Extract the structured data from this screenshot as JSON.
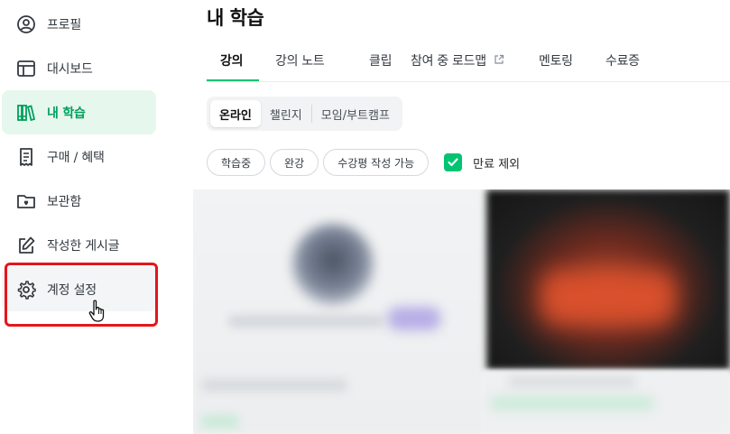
{
  "sidebar": {
    "items": [
      {
        "label": "프로필",
        "icon": "user-circle-icon"
      },
      {
        "label": "대시보드",
        "icon": "dashboard-icon"
      },
      {
        "label": "내 학습",
        "icon": "books-icon",
        "active": true
      },
      {
        "label": "구매 / 혜택",
        "icon": "receipt-icon"
      },
      {
        "label": "보관함",
        "icon": "folder-heart-icon"
      },
      {
        "label": "작성한 게시글",
        "icon": "edit-icon"
      },
      {
        "label": "계정 설정",
        "icon": "gear-icon"
      }
    ]
  },
  "main": {
    "title": "내 학습",
    "tabs": [
      {
        "label": "강의",
        "active": true
      },
      {
        "label": "강의 노트"
      },
      {
        "label": "클립"
      },
      {
        "label": "참여 중 로드맵"
      },
      {
        "label": "멘토링"
      },
      {
        "label": "수료증"
      }
    ],
    "segments": [
      {
        "label": "온라인",
        "active": true
      },
      {
        "label": "챌린지"
      },
      {
        "label": "모임/부트캠프"
      }
    ],
    "filters": [
      "학습중",
      "완강",
      "수강평 작성 가능"
    ],
    "checkbox": {
      "label": "만료 제외",
      "checked": true
    }
  },
  "colors": {
    "accent": "#00c471",
    "active_bg": "#e6f7ee",
    "highlight": "#e5151b"
  }
}
